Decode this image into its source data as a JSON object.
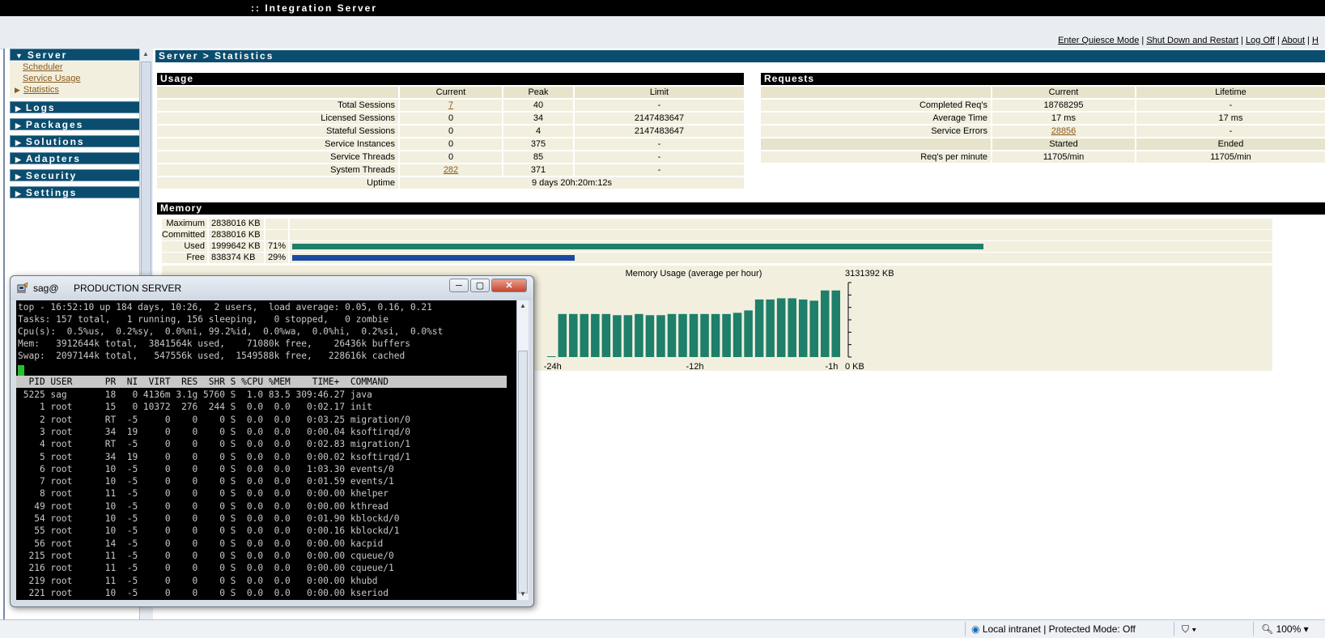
{
  "app": {
    "title": ":: Integration Server",
    "top_links": [
      "Enter Quiesce Mode",
      "Shut Down and Restart",
      "Log Off",
      "About",
      "H"
    ]
  },
  "nav": {
    "server": {
      "label": "Server",
      "items": [
        "Scheduler",
        "Service Usage",
        "Statistics"
      ],
      "active": "Statistics"
    },
    "sections": [
      "Logs",
      "Packages",
      "Solutions",
      "Adapters",
      "Security",
      "Settings"
    ]
  },
  "page": {
    "breadcrumb": "Server > Statistics"
  },
  "usage": {
    "title": "Usage",
    "headers": [
      "Current",
      "Peak",
      "Limit"
    ],
    "rows": [
      {
        "label": "Total Sessions",
        "current": "7",
        "peak": "40",
        "limit": "-"
      },
      {
        "label": "Licensed Sessions",
        "current": "0",
        "peak": "34",
        "limit": "2147483647"
      },
      {
        "label": "Stateful Sessions",
        "current": "0",
        "peak": "4",
        "limit": "2147483647"
      },
      {
        "label": "Service Instances",
        "current": "0",
        "peak": "375",
        "limit": "-"
      },
      {
        "label": "Service Threads",
        "current": "0",
        "peak": "85",
        "limit": "-"
      },
      {
        "label": "System Threads",
        "current": "282",
        "peak": "371",
        "limit": "-"
      }
    ],
    "uptime_label": "Uptime",
    "uptime_value": "9 days 20h:20m:12s"
  },
  "requests": {
    "title": "Requests",
    "headers": [
      "Current",
      "Lifetime"
    ],
    "rows": [
      {
        "label": "Completed Req's",
        "current": "18768295",
        "lifetime": "-"
      },
      {
        "label": "Average Time",
        "current": "17 ms",
        "lifetime": "17 ms"
      },
      {
        "label": "Service Errors",
        "current": "28856",
        "lifetime": "-"
      }
    ],
    "headers2": [
      "Started",
      "Ended"
    ],
    "rpm": {
      "label": "Req's per minute",
      "started": "11705/min",
      "ended": "11705/min"
    }
  },
  "memory": {
    "title": "Memory",
    "rows": [
      {
        "label": "Maximum",
        "value": "2838016 KB",
        "percent": "",
        "fraction": 0,
        "color": ""
      },
      {
        "label": "Committed",
        "value": "2838016 KB",
        "percent": "",
        "fraction": 0,
        "color": ""
      },
      {
        "label": "Used",
        "value": "1999642 KB",
        "percent": "71%",
        "fraction": 0.71,
        "color": "#1e7f6a"
      },
      {
        "label": "Free",
        "value": "838374 KB",
        "percent": "29%",
        "fraction": 0.29,
        "color": "#1a4aa0"
      }
    ]
  },
  "chart_data": {
    "type": "bar",
    "title": "Memory Usage (average per hour)",
    "ymax_label": "3131392 KB",
    "ymin_label": "0 KB",
    "xtick_labels": [
      "-24h",
      "-12h",
      "-1h"
    ],
    "ylim": [
      0,
      3131392
    ],
    "bar_color": "#1e7f6a",
    "values": [
      30000,
      1810000,
      1810000,
      1810000,
      1810000,
      1810000,
      1760000,
      1760000,
      1810000,
      1760000,
      1760000,
      1810000,
      1810000,
      1810000,
      1810000,
      1810000,
      1810000,
      1860000,
      1960000,
      2420000,
      2420000,
      2470000,
      2470000,
      2420000,
      2370000,
      2800000,
      2800000
    ]
  },
  "terminal": {
    "user_label": "sag@",
    "window_title": "PRODUCTION SERVER",
    "summary_lines": [
      "top - 16:52:10 up 184 days, 10:26,  2 users,  load average: 0.05, 0.16, 0.21",
      "Tasks: 157 total,   1 running, 156 sleeping,   0 stopped,   0 zombie",
      "Cpu(s):  0.5%us,  0.2%sy,  0.0%ni, 99.2%id,  0.0%wa,  0.0%hi,  0.2%si,  0.0%st",
      "Mem:   3912644k total,  3841564k used,    71080k free,    26436k buffers",
      "Swap:  2097144k total,   547556k used,  1549588k free,   228616k cached"
    ],
    "header_line": "  PID USER      PR  NI  VIRT  RES  SHR S %CPU %MEM    TIME+  COMMAND",
    "process_lines": [
      " 5225 sag       18   0 4136m 3.1g 5760 S  1.0 83.5 309:46.27 java",
      "    1 root      15   0 10372  276  244 S  0.0  0.0   0:02.17 init",
      "    2 root      RT  -5     0    0    0 S  0.0  0.0   0:03.25 migration/0",
      "    3 root      34  19     0    0    0 S  0.0  0.0   0:00.04 ksoftirqd/0",
      "    4 root      RT  -5     0    0    0 S  0.0  0.0   0:02.83 migration/1",
      "    5 root      34  19     0    0    0 S  0.0  0.0   0:00.02 ksoftirqd/1",
      "    6 root      10  -5     0    0    0 S  0.0  0.0   1:03.30 events/0",
      "    7 root      10  -5     0    0    0 S  0.0  0.0   0:01.59 events/1",
      "    8 root      11  -5     0    0    0 S  0.0  0.0   0:00.00 khelper",
      "   49 root      10  -5     0    0    0 S  0.0  0.0   0:00.00 kthread",
      "   54 root      10  -5     0    0    0 S  0.0  0.0   0:01.90 kblockd/0",
      "   55 root      10  -5     0    0    0 S  0.0  0.0   0:00.16 kblockd/1",
      "   56 root      14  -5     0    0    0 S  0.0  0.0   0:00.00 kacpid",
      "  215 root      11  -5     0    0    0 S  0.0  0.0   0:00.00 cqueue/0",
      "  216 root      11  -5     0    0    0 S  0.0  0.0   0:00.00 cqueue/1",
      "  219 root      11  -5     0    0    0 S  0.0  0.0   0:00.00 khubd",
      "  221 root      10  -5     0    0    0 S  0.0  0.0   0:00.00 kseriod"
    ]
  },
  "statusbar": {
    "zone": "Local intranet | Protected Mode: Off",
    "zoom": "100%"
  }
}
